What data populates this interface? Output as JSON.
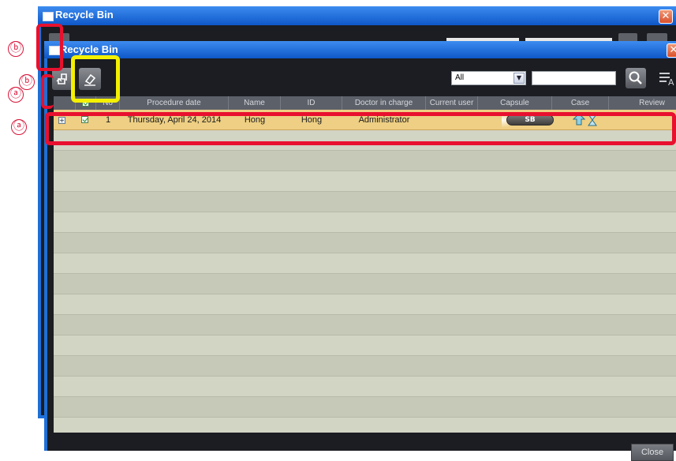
{
  "back_window": {
    "title": "Recycle Bin",
    "close_glyph": "✕"
  },
  "front_window": {
    "title": "Recycle Bin",
    "close_glyph": "✕"
  },
  "toolbar": {
    "restore_icon": "restore-icon",
    "erase_icon": "eraser-icon",
    "filter_value": "All",
    "search_placeholder": "",
    "search_icon": "search-icon",
    "menu_icon": "list-menu-icon"
  },
  "table": {
    "columns": [
      "",
      "",
      "No",
      "Procedure date",
      "Name",
      "ID",
      "Doctor in charge",
      "Current user",
      "Capsule",
      "Case",
      "Review"
    ],
    "rows": [
      {
        "no": "1",
        "procedure_date": "Thursday, April 24, 2014",
        "name": "Hong",
        "id": "Hong",
        "doctor": "Administrator",
        "current_user": "",
        "capsule": "SB",
        "checked": true
      }
    ]
  },
  "footer": {
    "close_label": "Close"
  },
  "annotations": {
    "a1": "ⓐ",
    "a2": "ⓐ",
    "b1": "ⓑ",
    "b2": "ⓑ"
  },
  "colors": {
    "highlight_row": "#eecf83",
    "annotation_red": "#e8102e",
    "annotation_yellow": "#f4f000"
  }
}
